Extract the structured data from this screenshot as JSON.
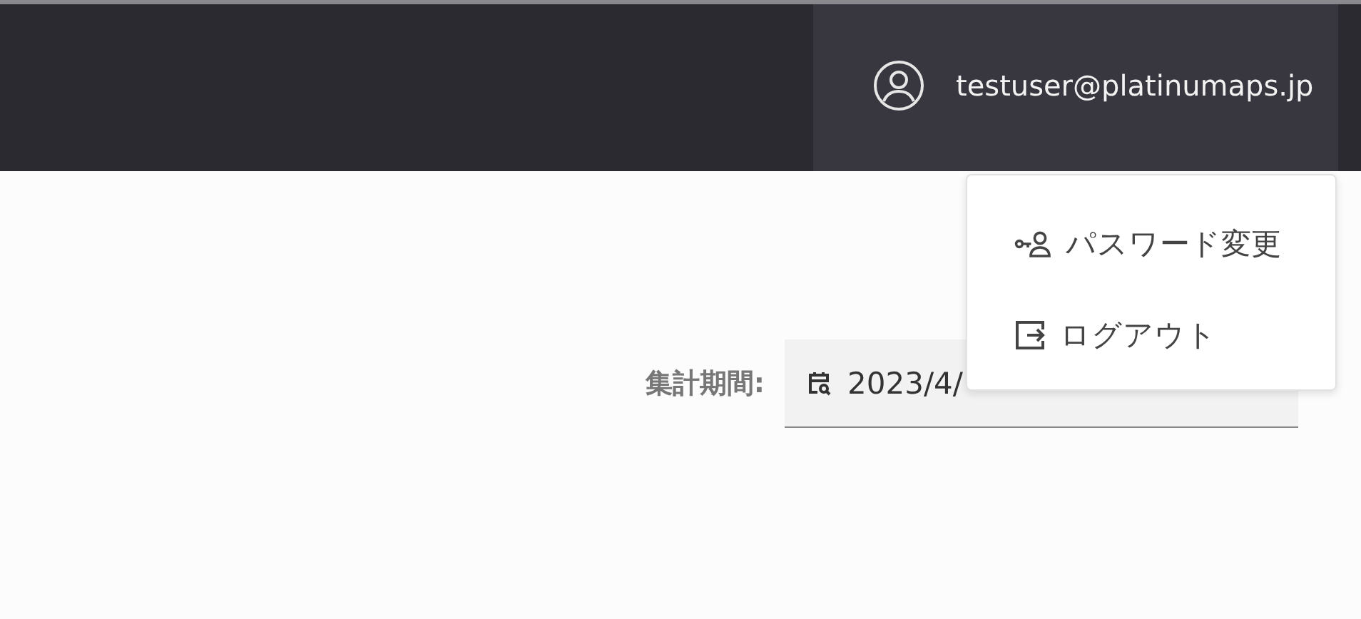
{
  "header": {
    "user_email": "testuser@platinumaps.jp"
  },
  "user_menu": {
    "items": [
      {
        "kind": "password",
        "label": "パスワード変更"
      },
      {
        "kind": "logout",
        "label": "ログアウト"
      }
    ]
  },
  "period": {
    "label": "集計期間:",
    "value": "2023/4/"
  }
}
